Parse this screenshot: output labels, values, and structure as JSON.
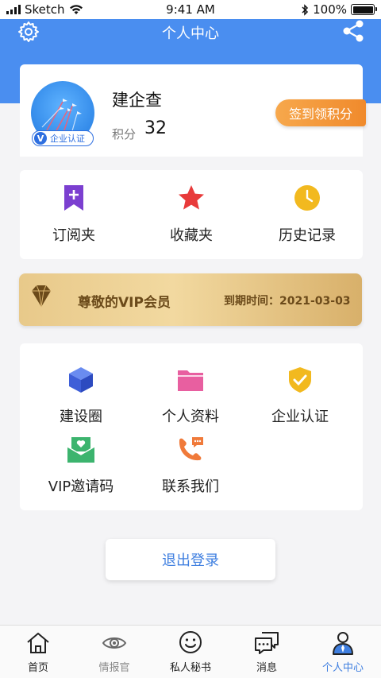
{
  "status_bar": {
    "carrier": "Sketch",
    "time": "9:41 AM",
    "battery": "100%"
  },
  "header": {
    "title": "个人中心",
    "settings_icon": "gear-icon",
    "share_icon": "share-icon",
    "color": "#4a8ef0"
  },
  "profile": {
    "name": "建企查",
    "badge": "企业认证",
    "badge_mark": "V",
    "points_label": "积分",
    "points_value": "32",
    "signin_button": "签到领积分"
  },
  "quick_links": [
    {
      "label": "订阅夹",
      "icon": "bookmark-plus-icon",
      "color": "#7b3fd0"
    },
    {
      "label": "收藏夹",
      "icon": "star-icon",
      "color": "#e83a3a"
    },
    {
      "label": "历史记录",
      "icon": "clock-icon",
      "color": "#f2b91f"
    }
  ],
  "vip": {
    "title": "尊敬的VIP会员",
    "expiry": "到期时间：2021-03-03",
    "icon": "diamond-icon"
  },
  "tools": [
    {
      "label": "建设圈",
      "icon": "cube-icon",
      "color": "#4a6ee0"
    },
    {
      "label": "个人资料",
      "icon": "folder-icon",
      "color": "#e85fa0"
    },
    {
      "label": "企业认证",
      "icon": "shield-check-icon",
      "color": "#f2b91f"
    },
    {
      "label": "VIP邀请码",
      "icon": "envelope-heart-icon",
      "color": "#3cb46e"
    },
    {
      "label": "联系我们",
      "icon": "phone-chat-icon",
      "color": "#f07a3a"
    }
  ],
  "logout_button": "退出登录",
  "tabbar": [
    {
      "label": "首页",
      "icon": "home-icon"
    },
    {
      "label": "情报官",
      "icon": "eye-icon"
    },
    {
      "label": "私人秘书",
      "icon": "smile-icon"
    },
    {
      "label": "消息",
      "icon": "message-icon"
    },
    {
      "label": "个人中心",
      "icon": "user-icon",
      "active": true
    }
  ]
}
